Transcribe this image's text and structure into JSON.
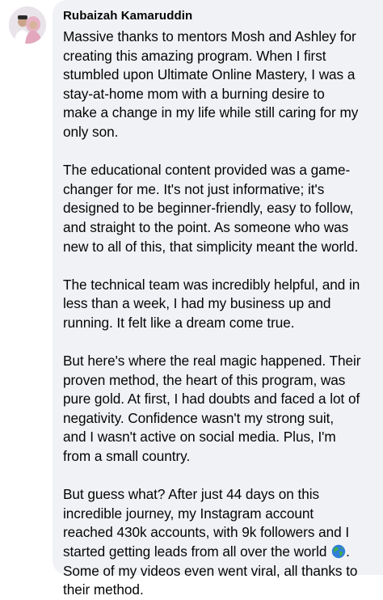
{
  "comment": {
    "author": "Rubaizah Kamaruddin",
    "avatar_icon": "profile-photo-avatar",
    "paragraphs": [
      [
        "Massive thanks to mentors Mosh and Ashley for",
        "creating this amazing program. When I first",
        "stumbled upon Ultimate Online Mastery, I was a",
        "stay-at-home mom with a burning desire to",
        "make a change in my life while still caring for my",
        "only son."
      ],
      [
        "The educational content provided was a game-",
        "changer for me. It's not just informative; it's",
        "designed to be beginner-friendly, easy to follow,",
        "and straight to the point. As someone who was",
        "new to all of this, that simplicity meant the world."
      ],
      [
        "The technical team was incredibly helpful, and in",
        "less than a week, I had my business up and",
        "running. It felt like a dream come true."
      ],
      [
        "But here's where the real magic happened. Their",
        "proven method, the heart of this program, was",
        "pure gold. At first, I had doubts and faced a lot of",
        "negativity. Confidence wasn't my strong suit,",
        "and I wasn't active on social media. Plus, I'm",
        "from a small country."
      ],
      [
        "But guess what? After just 44 days on this",
        "incredible journey, my Instagram account",
        "reached 430k accounts, with 9k followers and I",
        "started getting leads from all over the world",
        "Some of my videos even went viral, all thanks to",
        "their method."
      ]
    ],
    "emoji_after": "globe-emoji",
    "trailing_punct": "."
  },
  "colors": {
    "bubble_bg": "#f0f2f5",
    "text": "#050505",
    "page_bg": "#ffffff"
  }
}
